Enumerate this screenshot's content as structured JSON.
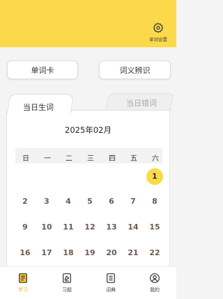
{
  "header": {
    "settings_label": "单词设置",
    "settings_icon": "gear-icon"
  },
  "actions": {
    "flashcard_label": "单词卡",
    "synonym_label": "词义辨识"
  },
  "tabs": {
    "active_label": "当日生词",
    "inactive_label": "当日错词"
  },
  "calendar": {
    "month_title": "2025年02月",
    "weekdays": [
      "日",
      "一",
      "二",
      "三",
      "四",
      "五",
      "六"
    ],
    "selected_day": "1",
    "days": [
      "1",
      "2",
      "3",
      "4",
      "5",
      "6",
      "7",
      "8",
      "9",
      "10",
      "11",
      "12",
      "13",
      "14",
      "15",
      "16",
      "17",
      "18",
      "19",
      "20",
      "21",
      "22"
    ]
  },
  "nav": {
    "items": [
      {
        "label": "学习",
        "icon": "book-icon"
      },
      {
        "label": "习题",
        "icon": "exercise-icon"
      },
      {
        "label": "词典",
        "icon": "dictionary-icon"
      },
      {
        "label": "我的",
        "icon": "profile-icon"
      }
    ]
  },
  "colors": {
    "accent": "#fcd94b",
    "day_text": "#6d5a4f"
  }
}
